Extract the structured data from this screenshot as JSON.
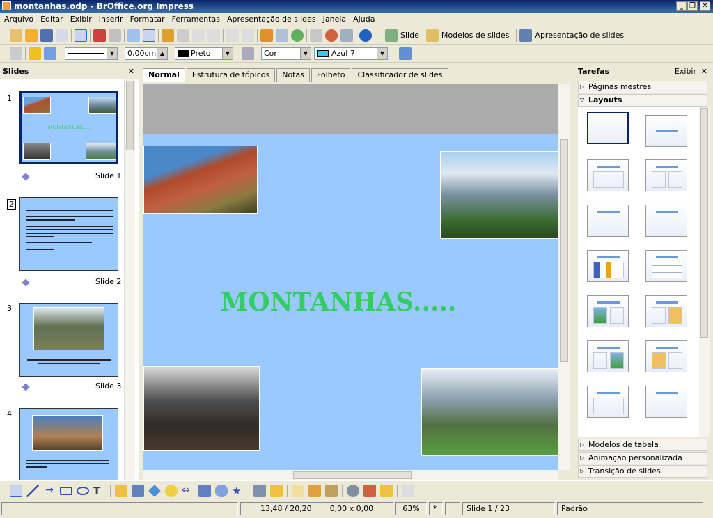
{
  "window": {
    "title": "montanhas.odp - BrOffice.org Impress",
    "controls": [
      "_",
      "❐",
      "✕"
    ]
  },
  "menu": [
    "Arquivo",
    "Editar",
    "Exibir",
    "Inserir",
    "Formatar",
    "Ferramentas",
    "Apresentação de slides",
    "Janela",
    "Ajuda"
  ],
  "toolbar": {
    "slide_label": "Slide",
    "modelos_label": "Modelos de slides",
    "apresentacao_label": "Apresentação de slides"
  },
  "line_toolbar": {
    "line_width": "0,00cm",
    "line_color": "Preto",
    "fill_type": "Cor",
    "fill_color": "Azul 7",
    "line_color_hex": "#000000",
    "fill_color_hex": "#33ccff"
  },
  "slides_panel": {
    "title": "Slides",
    "slides": [
      {
        "num": "1",
        "label": "Slide 1",
        "title": "MONTANHAS....."
      },
      {
        "num": "2",
        "label": "Slide 2"
      },
      {
        "num": "3",
        "label": "Slide 3"
      },
      {
        "num": "4",
        "label": ""
      }
    ]
  },
  "view_tabs": [
    "Normal",
    "Estrutura de tópicos",
    "Notas",
    "Folheto",
    "Classificador de slides"
  ],
  "slide": {
    "title": "MONTANHAS.....",
    "background": "#99c9ff",
    "title_color": "#33cc66"
  },
  "tasks": {
    "title": "Tarefas",
    "view_label": "Exibir",
    "sections": {
      "master": "Páginas mestres",
      "layouts": "Layouts",
      "tables": "Modelos de tabela",
      "animation": "Animação personalizada",
      "transition": "Transição de slides"
    }
  },
  "status": {
    "position": "13,48 / 20,20",
    "size": "0,00 x 0,00",
    "zoom": "63%",
    "modified": "*",
    "slide": "Slide 1 / 23",
    "layout": "Padrão"
  }
}
